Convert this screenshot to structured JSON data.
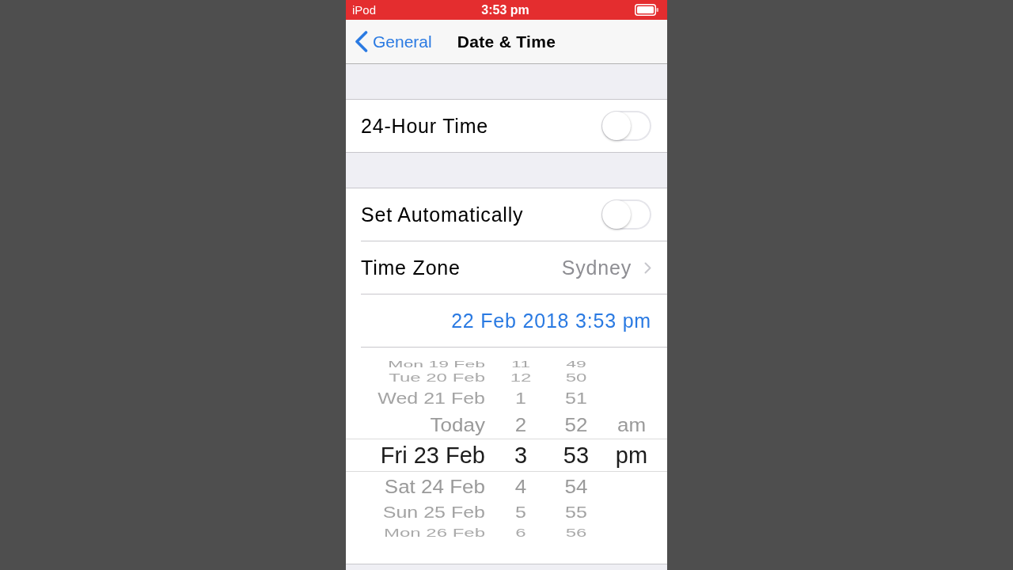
{
  "status_bar": {
    "carrier": "iPod",
    "time": "3:53 pm"
  },
  "nav_bar": {
    "back": "General",
    "title": "Date & Time"
  },
  "groups": [
    {
      "rows": [
        {
          "kind": "toggle",
          "label": "24-Hour Time",
          "on": false
        }
      ]
    },
    {
      "rows": [
        {
          "kind": "toggle",
          "label": "Set Automatically",
          "on": false
        },
        {
          "kind": "link",
          "label": "Time Zone",
          "value": "Sydney"
        },
        {
          "kind": "date",
          "value": "22 Feb 2018 3:53 pm",
          "expanded": true
        },
        {
          "kind": "picker",
          "columns": [
            {
              "kind": "date",
              "items": [
                {
                  "label": "Mon 19 Feb",
                  "selected": false
                },
                {
                  "label": "Tue 20 Feb",
                  "selected": false
                },
                {
                  "label": "Wed 21 Feb",
                  "selected": false
                },
                {
                  "label": "Today",
                  "selected": false
                },
                {
                  "label": "Fri 23 Feb",
                  "selected": true
                },
                {
                  "label": "Sat 24 Feb",
                  "selected": false
                },
                {
                  "label": "Sun 25 Feb",
                  "selected": false
                },
                {
                  "label": "Mon 26 Feb",
                  "selected": false
                }
              ]
            },
            {
              "kind": "hour",
              "items": [
                {
                  "label": "11",
                  "selected": false
                },
                {
                  "label": "12",
                  "selected": false
                },
                {
                  "label": "1",
                  "selected": false
                },
                {
                  "label": "2",
                  "selected": false
                },
                {
                  "label": "3",
                  "selected": true
                },
                {
                  "label": "4",
                  "selected": false
                },
                {
                  "label": "5",
                  "selected": false
                },
                {
                  "label": "6",
                  "selected": false
                }
              ]
            },
            {
              "kind": "minute",
              "items": [
                {
                  "label": "49",
                  "selected": false
                },
                {
                  "label": "50",
                  "selected": false
                },
                {
                  "label": "51",
                  "selected": false
                },
                {
                  "label": "52",
                  "selected": false
                },
                {
                  "label": "53",
                  "selected": true
                },
                {
                  "label": "54",
                  "selected": false
                },
                {
                  "label": "55",
                  "selected": false
                },
                {
                  "label": "56",
                  "selected": false
                }
              ]
            },
            {
              "kind": "period",
              "items": [
                {
                  "label": "am",
                  "selected": false
                },
                {
                  "label": "pm",
                  "selected": true
                }
              ]
            }
          ]
        }
      ]
    }
  ]
}
